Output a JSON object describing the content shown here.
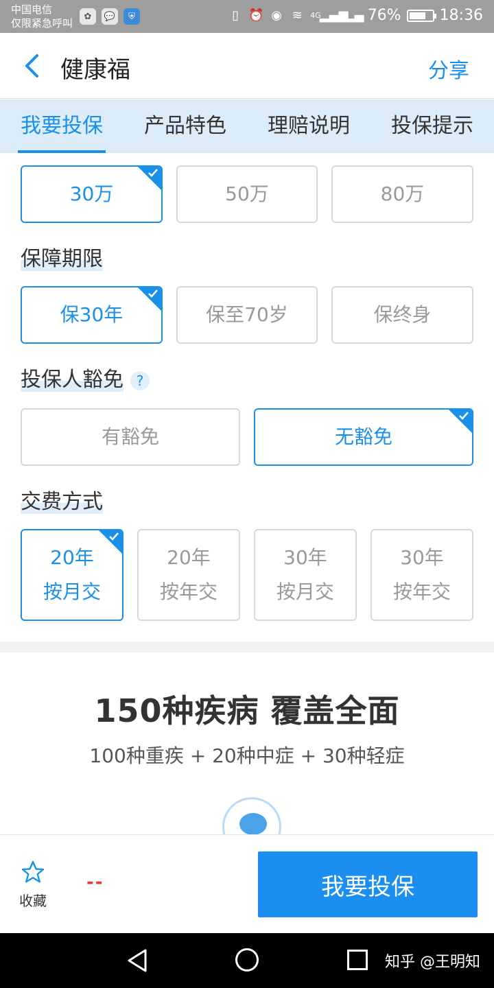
{
  "status_bar": {
    "carrier_line1": "中国电信",
    "carrier_line2": "仅限紧急呼叫",
    "network": "4G",
    "battery": "76%",
    "battery_level": 0.76,
    "time": "18:36"
  },
  "header": {
    "title": "健康福",
    "share_label": "分享"
  },
  "tabs": [
    {
      "label": "我要投保",
      "active": true
    },
    {
      "label": "产品特色",
      "active": false
    },
    {
      "label": "理赔说明",
      "active": false
    },
    {
      "label": "投保提示",
      "active": false
    }
  ],
  "coverage_amount": {
    "options": [
      "30万",
      "50万",
      "80万"
    ],
    "selected": "30万"
  },
  "term": {
    "label": "保障期限",
    "options": [
      "保30年",
      "保至70岁",
      "保终身"
    ],
    "selected": "保30年"
  },
  "waiver": {
    "label": "投保人豁免",
    "help_icon": "?",
    "options": [
      "有豁免",
      "无豁免"
    ],
    "selected": "无豁免"
  },
  "payment": {
    "label": "交费方式",
    "options": [
      {
        "line1": "20年",
        "line2": "按月交"
      },
      {
        "line1": "20年",
        "line2": "按年交"
      },
      {
        "line1": "30年",
        "line2": "按月交"
      },
      {
        "line1": "30年",
        "line2": "按年交"
      }
    ],
    "selected_index": 0
  },
  "feature": {
    "title": "150种疾病 覆盖全面",
    "subtitle": "100种重疾 + 20种中症 + 30种轻症"
  },
  "action_bar": {
    "favorite_label": "收藏",
    "price": "--",
    "buy_label": "我要投保"
  },
  "watermark": "知乎 @王明知",
  "colors": {
    "accent": "#1a90e8",
    "tab_bg": "#dcecf9",
    "price": "#e53935",
    "status_bar": "#9e9e9e"
  }
}
